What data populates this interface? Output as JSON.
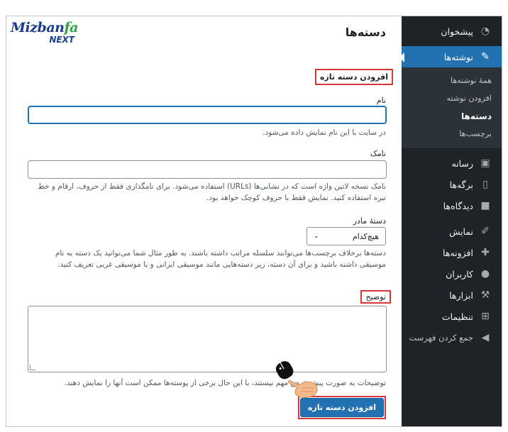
{
  "page": {
    "title": "دسته‌ها",
    "section_title": "افزودن دسته تازه"
  },
  "logo": {
    "brand_main": "Mizban",
    "brand_accent": "fa",
    "brand_sub": "NEXT"
  },
  "form": {
    "name": {
      "label": "نام",
      "value": "",
      "help": "در سایت با این نام نمایش داده می‌شود."
    },
    "slug": {
      "label": "نامک",
      "value": "",
      "help": "نامک نسخه لاتین واژه است که در نشانی‌ها (URLs) استفاده می‌شود. برای نامگذاری فقط از حروف، ارقام و خط تیره استفاده کنید. نمایش فقط با حروف کوچک خواهد بود."
    },
    "parent": {
      "label": "دستهٔ مادر",
      "selected": "هیچ‌کدام",
      "help": "دسته‌ها برخلاف برچسب‌ها می‌توانند سلسله مراتب داشته باشند. به طور مثال شما می‌توانید یک دسته به نام موسیقی داشته باشید و برای آن دسته، زیر دسته‌هایی مانند موسیقی ایرانی و یا موسیقی غربی تعریف کنید."
    },
    "description": {
      "label": "توضیح",
      "value": "",
      "help": "توضیحات به صورت پیش فرض مهم نیستند، با این حال برخی از پوسته‌ها ممکن است آنها را نمایش دهند."
    },
    "submit_label": "افزودن دسته تازه"
  },
  "sidebar": {
    "items": [
      {
        "label": "پیشخوان",
        "icon": "dashboard-icon"
      },
      {
        "label": "نوشته‌ها",
        "icon": "pin-icon",
        "active": true
      },
      {
        "label": "رسانه",
        "icon": "media-icon"
      },
      {
        "label": "برگه‌ها",
        "icon": "pages-icon"
      },
      {
        "label": "دیدگاه‌ها",
        "icon": "comments-icon"
      },
      {
        "label": "نمایش",
        "icon": "brush-icon"
      },
      {
        "label": "افزونه‌ها",
        "icon": "plugin-icon"
      },
      {
        "label": "کاربران",
        "icon": "users-icon"
      },
      {
        "label": "ابزارها",
        "icon": "wrench-icon"
      },
      {
        "label": "تنظیمات",
        "icon": "settings-icon"
      },
      {
        "label": "جمع کردن فهرست",
        "icon": "collapse-icon"
      }
    ],
    "submenu": [
      {
        "label": "همهٔ نوشته‌ها"
      },
      {
        "label": "افزودن نوشته"
      },
      {
        "label": "دسته‌ها",
        "current": true
      },
      {
        "label": "برچسب‌ها"
      }
    ]
  },
  "colors": {
    "sidebar_bg": "#1d2327",
    "active_blue": "#2271b1",
    "highlight_red": "#d63638"
  }
}
